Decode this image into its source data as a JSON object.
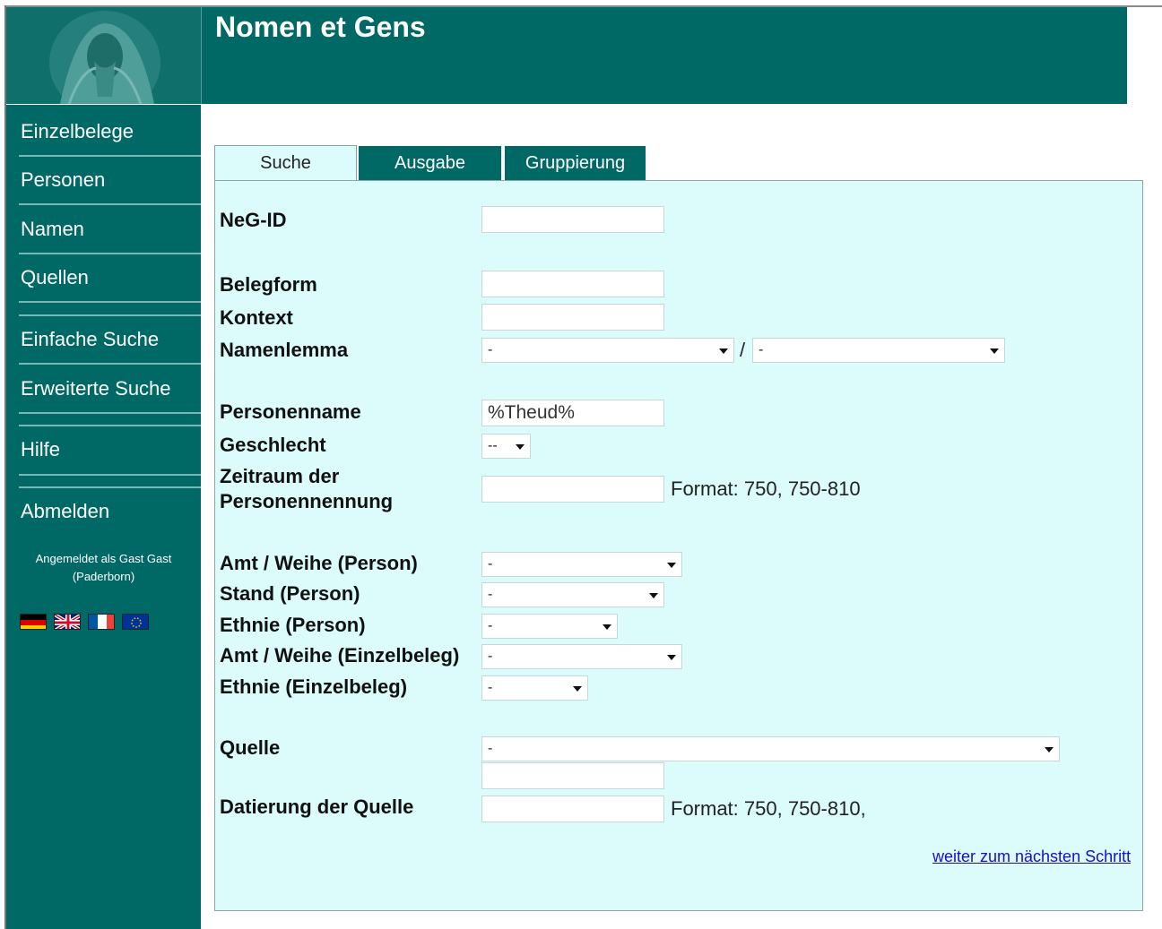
{
  "header": {
    "title": "Nomen et Gens"
  },
  "sidebar": {
    "items": [
      {
        "label": "Einzelbelege"
      },
      {
        "label": "Personen"
      },
      {
        "label": "Namen"
      },
      {
        "label": "Quellen"
      },
      {
        "label": "Einfache Suche"
      },
      {
        "label": "Erweiterte Suche"
      },
      {
        "label": "Hilfe"
      },
      {
        "label": "Abmelden"
      }
    ],
    "login_line1": "Angemeldet als Gast Gast",
    "login_line2": "(Paderborn)",
    "flags": [
      "de-flag-icon",
      "uk-flag-icon",
      "fr-flag-icon",
      "eu-flag-icon"
    ]
  },
  "tabs": [
    {
      "label": "Suche",
      "active": true
    },
    {
      "label": "Ausgabe",
      "active": false
    },
    {
      "label": "Gruppierung",
      "active": false
    }
  ],
  "form": {
    "neg_id": {
      "label": "NeG-ID",
      "value": ""
    },
    "belegform": {
      "label": "Belegform",
      "value": ""
    },
    "kontext": {
      "label": "Kontext",
      "value": ""
    },
    "namenlemma": {
      "label": "Namenlemma",
      "value1": "-",
      "separator": "/",
      "value2": "-"
    },
    "personenname": {
      "label": "Personenname",
      "value": "%Theud%"
    },
    "geschlecht": {
      "label": "Geschlecht",
      "value": "--"
    },
    "zeitraum": {
      "label_line1": "Zeitraum der",
      "label_line2": "Personennennung",
      "value": "",
      "hint": "Format: 750, 750-810"
    },
    "amt_person": {
      "label": "Amt / Weihe (Person)",
      "value": "-"
    },
    "stand_person": {
      "label": "Stand (Person)",
      "value": "-"
    },
    "ethnie_person": {
      "label": "Ethnie (Person)",
      "value": "-"
    },
    "amt_einzelbeleg": {
      "label": "Amt / Weihe (Einzelbeleg)",
      "value": "-"
    },
    "ethnie_einzelbeleg": {
      "label": "Ethnie (Einzelbeleg)",
      "value": "-"
    },
    "quelle": {
      "label": "Quelle",
      "value": "-",
      "extra_value": ""
    },
    "datierung": {
      "label": "Datierung der Quelle",
      "value": "",
      "hint": "Format: 750, 750-810,"
    },
    "next_link": "weiter zum nächsten Schritt"
  },
  "colors": {
    "teal": "#006966",
    "panel": "#dcfbfb",
    "link": "#1a0dcc"
  }
}
